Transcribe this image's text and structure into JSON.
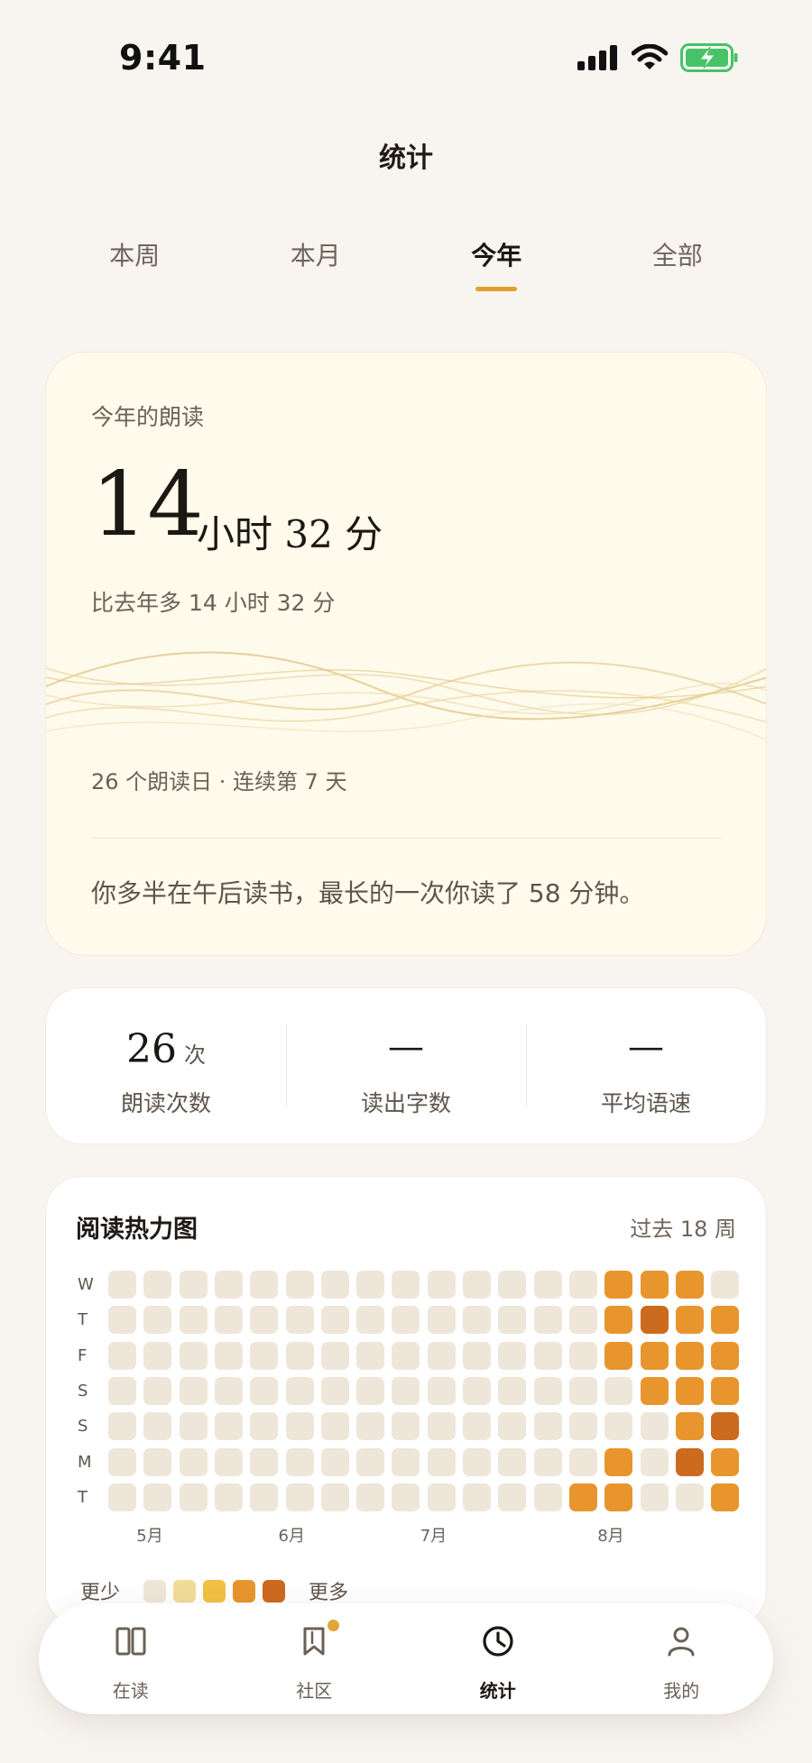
{
  "status_bar": {
    "time": "9:41"
  },
  "header": {
    "title": "统计"
  },
  "tabs": [
    {
      "label": "本周",
      "active": false
    },
    {
      "label": "本月",
      "active": false
    },
    {
      "label": "今年",
      "active": true
    },
    {
      "label": "全部",
      "active": false
    }
  ],
  "summary": {
    "label": "今年的朗读",
    "hours": "14",
    "rest": "小时 32 分",
    "compare": "比去年多 14 小时 32 分",
    "days": "26 个朗读日 · 连续第 7 天",
    "insight": "你多半在午后读书，最长的一次你读了 58 分钟。"
  },
  "metrics": [
    {
      "value": "26",
      "unit": "次",
      "label": "朗读次数"
    },
    {
      "value": "—",
      "unit": "",
      "label": "读出字数"
    },
    {
      "value": "—",
      "unit": "",
      "label": "平均语速"
    }
  ],
  "heatmap": {
    "title": "阅读热力图",
    "range": "过去 18 周",
    "day_labels": [
      "W",
      "T",
      "F",
      "S",
      "S",
      "M",
      "T"
    ],
    "months": [
      {
        "label": "5月",
        "week": 1
      },
      {
        "label": "6月",
        "week": 5
      },
      {
        "label": "7月",
        "week": 9
      },
      {
        "label": "8月",
        "week": 14
      }
    ],
    "levels_colors": [
      "#efe6da",
      "#f1dc98",
      "#f2c044",
      "#e8952e",
      "#cc6a1e"
    ],
    "rows": [
      [
        0,
        0,
        0,
        0,
        0,
        0,
        0,
        0,
        0,
        0,
        0,
        0,
        0,
        0,
        3,
        3,
        3,
        0
      ],
      [
        0,
        0,
        0,
        0,
        0,
        0,
        0,
        0,
        0,
        0,
        0,
        0,
        0,
        0,
        3,
        4,
        3,
        3
      ],
      [
        0,
        0,
        0,
        0,
        0,
        0,
        0,
        0,
        0,
        0,
        0,
        0,
        0,
        0,
        3,
        3,
        3,
        3
      ],
      [
        0,
        0,
        0,
        0,
        0,
        0,
        0,
        0,
        0,
        0,
        0,
        0,
        0,
        0,
        0,
        3,
        3,
        3
      ],
      [
        0,
        0,
        0,
        0,
        0,
        0,
        0,
        0,
        0,
        0,
        0,
        0,
        0,
        0,
        0,
        0,
        3,
        4
      ],
      [
        0,
        0,
        0,
        0,
        0,
        0,
        0,
        0,
        0,
        0,
        0,
        0,
        0,
        0,
        3,
        0,
        4,
        3
      ],
      [
        0,
        0,
        0,
        0,
        0,
        0,
        0,
        0,
        0,
        0,
        0,
        0,
        0,
        3,
        3,
        0,
        0,
        3
      ]
    ],
    "legend_less": "更少",
    "legend_more": "更多"
  },
  "nav": [
    {
      "label": "在读",
      "icon": "book-open-icon",
      "active": false
    },
    {
      "label": "社区",
      "icon": "bookmark-icon",
      "active": false,
      "badge": true
    },
    {
      "label": "统计",
      "icon": "clock-icon",
      "active": true
    },
    {
      "label": "我的",
      "icon": "person-icon",
      "active": false
    }
  ]
}
